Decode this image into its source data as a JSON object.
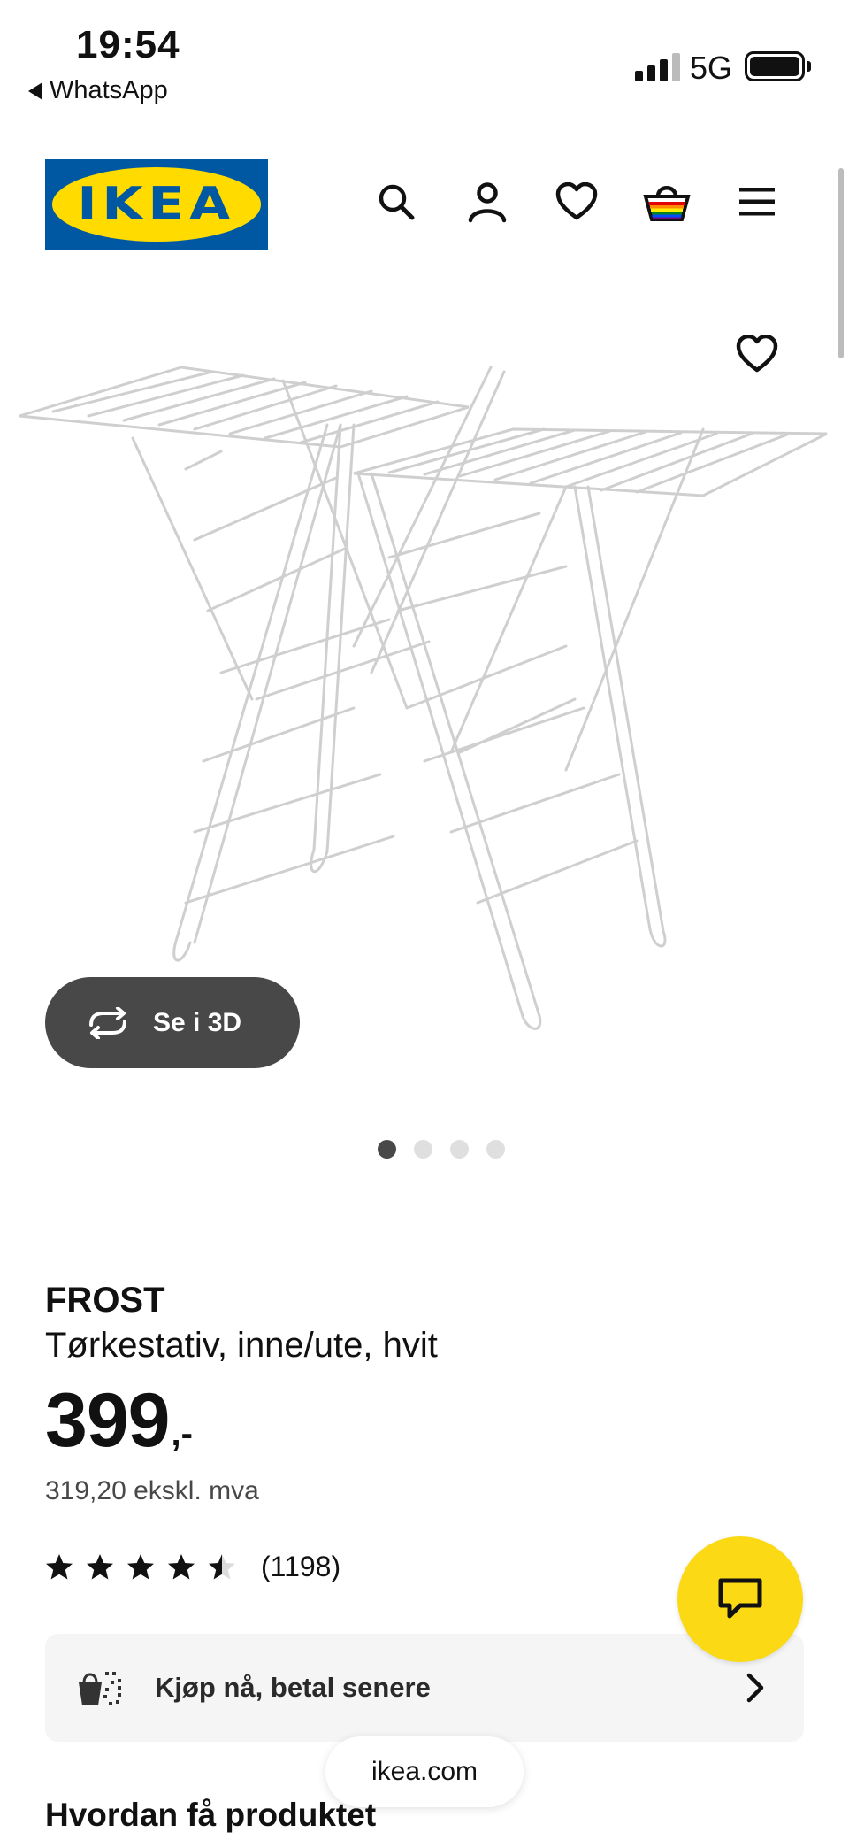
{
  "status_bar": {
    "time": "19:54",
    "back_app": "WhatsApp",
    "network": "5G"
  },
  "header": {
    "logo_text": "IKEA",
    "icons": [
      "search-icon",
      "profile-icon",
      "favourites-icon",
      "shopping-bag-icon",
      "menu-icon"
    ]
  },
  "gallery": {
    "view_3d_label": "Se i 3D",
    "slide_count": 4,
    "active_slide": 1
  },
  "product": {
    "name": "FROST",
    "description": "Tørkestativ, inne/ute, hvit",
    "price_main": "399",
    "price_suffix": ",-",
    "price_ex_vat": "319,20 ekskl. mva",
    "rating": 4.5,
    "rating_max": 5,
    "review_count": "(1198)"
  },
  "bnpl": {
    "label": "Kjøp nå, betal senere"
  },
  "browser": {
    "url": "ikea.com"
  },
  "section": {
    "how_to_get": "Hvordan få produktet"
  },
  "colors": {
    "ikea_blue": "#0058a3",
    "ikea_yellow": "#ffdb00",
    "chat_yellow": "#fbd914",
    "dark_button": "#484848"
  }
}
